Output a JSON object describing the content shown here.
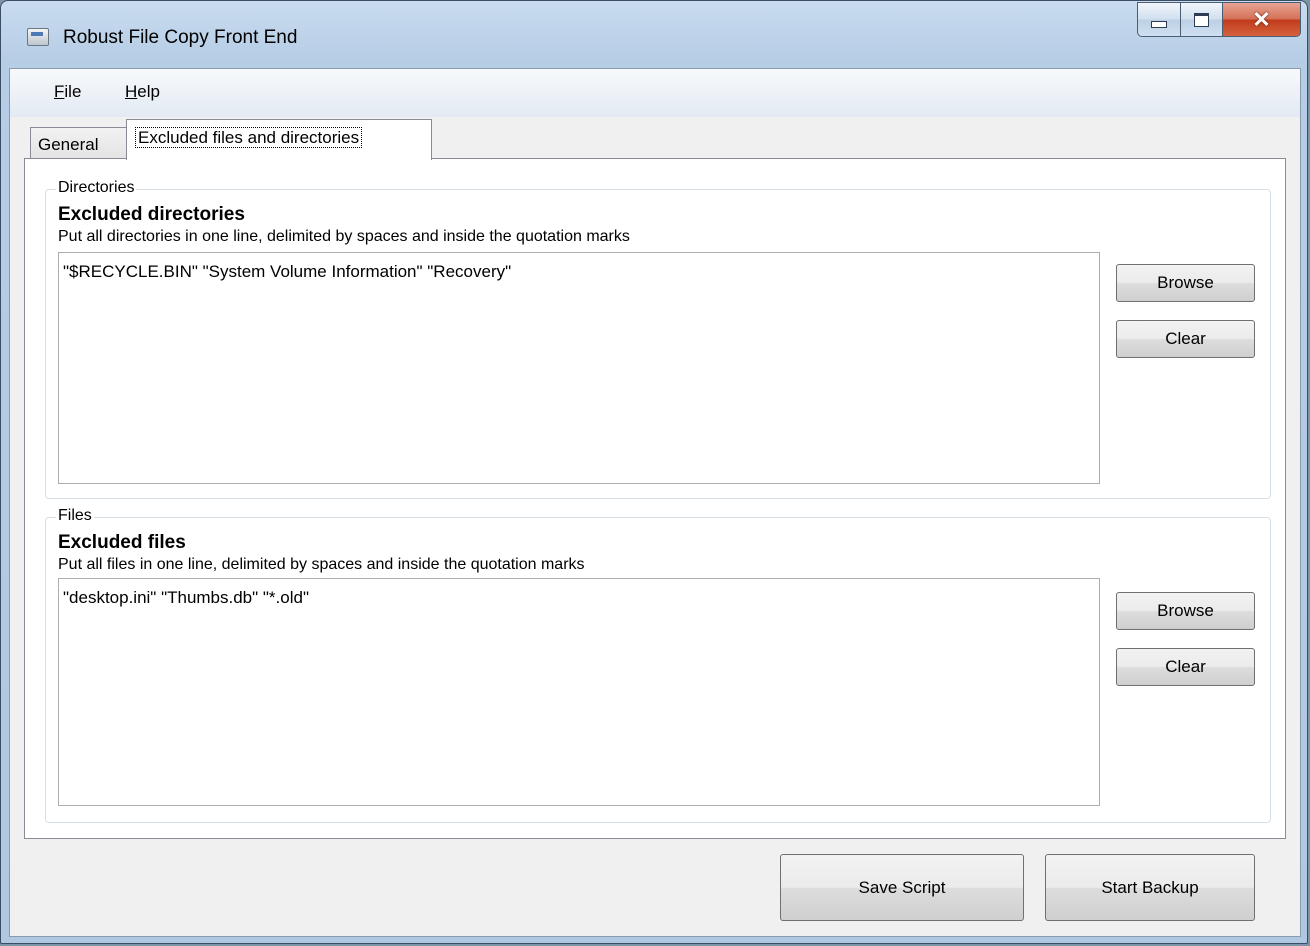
{
  "window": {
    "title": "Robust File Copy Front End"
  },
  "menu": {
    "file_rest": "ile",
    "file_key": "F",
    "help_rest": "elp",
    "help_key": "H"
  },
  "tabs": [
    {
      "label": "General",
      "selected": false
    },
    {
      "label": "Excluded files and directories",
      "selected": true
    }
  ],
  "directories": {
    "caption": "Directories",
    "heading": "Excluded directories",
    "description": "Put all directories in one line, delimited by spaces and inside the quotation marks",
    "value": "\"$RECYCLE.BIN\" \"System Volume Information\" \"Recovery\"",
    "browse_label": "Browse",
    "clear_label": "Clear"
  },
  "files": {
    "caption": "Files",
    "heading": "Excluded files",
    "description": "Put all files in one line, delimited by spaces and inside the quotation marks",
    "value": "\"desktop.ini\" \"Thumbs.db\" \"*.old\"",
    "browse_label": "Browse",
    "clear_label": "Clear"
  },
  "footer": {
    "save_label": "Save Script",
    "start_label": "Start Backup"
  },
  "colors": {
    "accent": "#4f79b4",
    "close_button": "#c13b1c"
  }
}
